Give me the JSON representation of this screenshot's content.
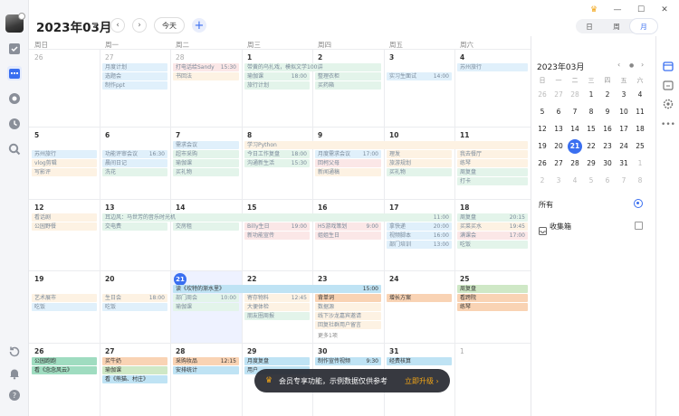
{
  "header": {
    "title": "2023年03月",
    "today_label": "今天",
    "views": [
      "日",
      "周",
      "月"
    ],
    "active_view": "月"
  },
  "weekdays": [
    "周日",
    "周一",
    "周二",
    "周三",
    "周四",
    "周五",
    "周六"
  ],
  "weeks": [
    [
      {
        "d": "26",
        "dim": true
      },
      {
        "d": "27",
        "dim": true
      },
      {
        "d": "28",
        "dim": true
      },
      {
        "d": "1"
      },
      {
        "d": "2"
      },
      {
        "d": "3"
      },
      {
        "d": "4"
      }
    ],
    [
      {
        "d": "5"
      },
      {
        "d": "6"
      },
      {
        "d": "7"
      },
      {
        "d": "8"
      },
      {
        "d": "9"
      },
      {
        "d": "10"
      },
      {
        "d": "11"
      }
    ],
    [
      {
        "d": "12"
      },
      {
        "d": "13"
      },
      {
        "d": "14"
      },
      {
        "d": "15"
      },
      {
        "d": "16"
      },
      {
        "d": "17"
      },
      {
        "d": "18"
      }
    ],
    [
      {
        "d": "19"
      },
      {
        "d": "20"
      },
      {
        "d": "21",
        "today": true
      },
      {
        "d": "22"
      },
      {
        "d": "23"
      },
      {
        "d": "24"
      },
      {
        "d": "25"
      }
    ],
    [
      {
        "d": "26"
      },
      {
        "d": "27"
      },
      {
        "d": "28"
      },
      {
        "d": "29"
      },
      {
        "d": "30"
      },
      {
        "d": "31"
      },
      {
        "d": "1",
        "dim": true
      }
    ]
  ],
  "events": [
    {
      "w": 0,
      "c": 1,
      "s": 1,
      "r": 0,
      "t": "月度计划",
      "time": "",
      "color": "#e0f0fb"
    },
    {
      "w": 0,
      "c": 1,
      "s": 1,
      "r": 1,
      "t": "选题会",
      "time": "",
      "color": "#e0f0fb"
    },
    {
      "w": 0,
      "c": 1,
      "s": 1,
      "r": 2,
      "t": "制作ppt",
      "time": "",
      "color": "#e0f0fb"
    },
    {
      "w": 0,
      "c": 2,
      "s": 1,
      "r": 0,
      "t": "打电话给Sandy",
      "time": "15:30",
      "color": "#fbe7e7"
    },
    {
      "w": 0,
      "c": 2,
      "s": 1,
      "r": 1,
      "t": "书回法",
      "time": "",
      "color": "#fdf2e3"
    },
    {
      "w": 0,
      "c": 3,
      "s": 2,
      "r": 0,
      "t": "带黄的乌扎戏，模拟文学100讲",
      "time": "",
      "color": "#e3f4ea"
    },
    {
      "w": 0,
      "c": 3,
      "s": 1,
      "r": 1,
      "t": "瑜伽课",
      "time": "18:00",
      "color": "#e3f4ea"
    },
    {
      "w": 0,
      "c": 3,
      "s": 1,
      "r": 2,
      "t": "旅行计划",
      "time": "",
      "color": "#e3f4ea"
    },
    {
      "w": 0,
      "c": 4,
      "s": 1,
      "r": 1,
      "t": "整理衣柜",
      "time": "",
      "color": "#e3f4ea"
    },
    {
      "w": 0,
      "c": 4,
      "s": 1,
      "r": 2,
      "t": "买药箱",
      "time": "",
      "color": "#e3f4ea"
    },
    {
      "w": 0,
      "c": 5,
      "s": 1,
      "r": 1,
      "t": "实习生面试",
      "time": "14:00",
      "color": "#e0f0fb"
    },
    {
      "w": 0,
      "c": 6,
      "s": 1,
      "r": 0,
      "t": "苏州旅行",
      "time": "",
      "color": "#e0f0fb"
    },
    {
      "w": 1,
      "c": 0,
      "s": 1,
      "r": 1,
      "t": "苏州旅行",
      "time": "",
      "color": "#e0f0fb"
    },
    {
      "w": 1,
      "c": 0,
      "s": 1,
      "r": 2,
      "t": "vlog剪辑",
      "time": "",
      "color": "#fdf2e3"
    },
    {
      "w": 1,
      "c": 0,
      "s": 1,
      "r": 3,
      "t": "写影评",
      "time": "",
      "color": "#fdf2e3"
    },
    {
      "w": 1,
      "c": 1,
      "s": 1,
      "r": 1,
      "t": "功能评审会议",
      "time": "16:30",
      "color": "#e0f0fb"
    },
    {
      "w": 1,
      "c": 1,
      "s": 1,
      "r": 2,
      "t": "晨间日记",
      "time": "",
      "color": "#e0f0fb"
    },
    {
      "w": 1,
      "c": 1,
      "s": 1,
      "r": 3,
      "t": "洗花",
      "time": "",
      "color": "#e3f4ea"
    },
    {
      "w": 1,
      "c": 2,
      "s": 1,
      "r": 0,
      "t": "需求会议",
      "time": "",
      "color": "#e0f0fb"
    },
    {
      "w": 1,
      "c": 2,
      "s": 1,
      "r": 1,
      "t": "超市采购",
      "time": "",
      "color": "#e3f4ea"
    },
    {
      "w": 1,
      "c": 2,
      "s": 1,
      "r": 2,
      "t": "瑜伽课",
      "time": "",
      "color": "#e3f4ea"
    },
    {
      "w": 1,
      "c": 2,
      "s": 1,
      "r": 3,
      "t": "买礼物",
      "time": "",
      "color": "#e3f4ea"
    },
    {
      "w": 1,
      "c": 3,
      "s": 4,
      "r": 0,
      "t": "学习Python",
      "time": "",
      "color": "#fdf2e3"
    },
    {
      "w": 1,
      "c": 3,
      "s": 1,
      "r": 1,
      "t": "今日工作复盘",
      "time": "18:00",
      "color": "#e3f4ea"
    },
    {
      "w": 1,
      "c": 3,
      "s": 1,
      "r": 2,
      "t": "沟通新生活",
      "time": "15:30",
      "color": "#e3f4ea"
    },
    {
      "w": 1,
      "c": 4,
      "s": 1,
      "r": 1,
      "t": "月度需求会议",
      "time": "17:00",
      "color": "#e0f0fb"
    },
    {
      "w": 1,
      "c": 4,
      "s": 1,
      "r": 2,
      "t": "回柯父母",
      "time": "",
      "color": "#fbe7e7"
    },
    {
      "w": 1,
      "c": 4,
      "s": 1,
      "r": 3,
      "t": "新闻通稿",
      "time": "",
      "color": "#fdf2e3"
    },
    {
      "w": 1,
      "c": 5,
      "s": 1,
      "r": 1,
      "t": "理发",
      "time": "",
      "color": "#fdf2e3"
    },
    {
      "w": 1,
      "c": 5,
      "s": 1,
      "r": 2,
      "t": "旅游规划",
      "time": "",
      "color": "#fdf2e3"
    },
    {
      "w": 1,
      "c": 5,
      "s": 1,
      "r": 3,
      "t": "买礼物",
      "time": "",
      "color": "#e3f4ea"
    },
    {
      "w": 1,
      "c": 6,
      "s": 1,
      "r": 1,
      "t": "我去餐厅",
      "time": "",
      "color": "#fdf2e3"
    },
    {
      "w": 1,
      "c": 6,
      "s": 1,
      "r": 2,
      "t": "练琴",
      "time": "",
      "color": "#fdf2e3"
    },
    {
      "w": 1,
      "c": 6,
      "s": 1,
      "r": 3,
      "t": "周复盘",
      "time": "",
      "color": "#e3f4ea"
    },
    {
      "w": 1,
      "c": 6,
      "s": 1,
      "r": 4,
      "t": "打卡",
      "time": "",
      "color": "#e3f4ea"
    },
    {
      "w": 2,
      "c": 0,
      "s": 1,
      "r": 0,
      "t": "看话剧",
      "time": "",
      "color": "#fdf2e3"
    },
    {
      "w": 2,
      "c": 0,
      "s": 1,
      "r": 1,
      "t": "公园野餐",
      "time": "",
      "color": "#fdf2e3"
    },
    {
      "w": 2,
      "c": 1,
      "s": 5,
      "r": 0,
      "t": "耳边风：马世芳的音乐时光机",
      "time": "11:00",
      "color": "#e3f4ea"
    },
    {
      "w": 2,
      "c": 1,
      "s": 1,
      "r": 1,
      "t": "交电费",
      "time": "",
      "color": "#e3f4ea"
    },
    {
      "w": 2,
      "c": 2,
      "s": 1,
      "r": 1,
      "t": "交房租",
      "time": "",
      "color": "#e3f4ea"
    },
    {
      "w": 2,
      "c": 3,
      "s": 1,
      "r": 1,
      "t": "Billy生日",
      "time": "19:00",
      "color": "#fbe7e7"
    },
    {
      "w": 2,
      "c": 3,
      "s": 1,
      "r": 2,
      "t": "新功能宣传",
      "time": "",
      "color": "#fbe7e7"
    },
    {
      "w": 2,
      "c": 4,
      "s": 1,
      "r": 1,
      "t": "H5游戏策划",
      "time": "9:00",
      "color": "#fbe7e7"
    },
    {
      "w": 2,
      "c": 4,
      "s": 1,
      "r": 2,
      "t": "姐姐生日",
      "time": "",
      "color": "#fbe7e7"
    },
    {
      "w": 2,
      "c": 5,
      "s": 1,
      "r": 1,
      "t": "拿快递",
      "time": "20:00",
      "color": "#e0f0fb"
    },
    {
      "w": 2,
      "c": 5,
      "s": 1,
      "r": 2,
      "t": "视频脚本",
      "time": "16:00",
      "color": "#e0f0fb"
    },
    {
      "w": 2,
      "c": 5,
      "s": 1,
      "r": 3,
      "t": "部门培训",
      "time": "13:00",
      "color": "#e0f0fb"
    },
    {
      "w": 2,
      "c": 6,
      "s": 1,
      "r": 0,
      "t": "周复盘",
      "time": "20:15",
      "color": "#e3f4ea"
    },
    {
      "w": 2,
      "c": 6,
      "s": 1,
      "r": 1,
      "t": "买菜买水",
      "time": "19:45",
      "color": "#fdf2e3"
    },
    {
      "w": 2,
      "c": 6,
      "s": 1,
      "r": 2,
      "t": "满课会",
      "time": "17:00",
      "color": "#fbe7e7"
    },
    {
      "w": 2,
      "c": 6,
      "s": 1,
      "r": 3,
      "t": "吃饭",
      "time": "",
      "color": "#e3f4ea"
    },
    {
      "w": 3,
      "c": 0,
      "s": 1,
      "r": 1,
      "t": "艺术展市",
      "time": "",
      "color": "#fdf2e3"
    },
    {
      "w": 3,
      "c": 0,
      "s": 1,
      "r": 2,
      "t": "吃饭",
      "time": "",
      "color": "#e0f0fb"
    },
    {
      "w": 3,
      "c": 1,
      "s": 1,
      "r": 1,
      "t": "生日会",
      "time": "18:00",
      "color": "#fdf2e3"
    },
    {
      "w": 3,
      "c": 1,
      "s": 1,
      "r": 2,
      "t": "吃饭",
      "time": "",
      "color": "#e0f0fb"
    },
    {
      "w": 3,
      "c": 2,
      "s": 3,
      "r": 0,
      "t": "读《坎特的渐水里》",
      "time": "15:00",
      "color": "#bfe3f4",
      "strong": true
    },
    {
      "w": 3,
      "c": 2,
      "s": 1,
      "r": 1,
      "t": "部门周会",
      "time": "10:00",
      "color": "#e3f4ea"
    },
    {
      "w": 3,
      "c": 2,
      "s": 1,
      "r": 2,
      "t": "瑜伽课",
      "time": "",
      "color": "#e3f4ea"
    },
    {
      "w": 3,
      "c": 3,
      "s": 1,
      "r": 1,
      "t": "寄存物料",
      "time": "12:45",
      "color": "#fdf2e3"
    },
    {
      "w": 3,
      "c": 3,
      "s": 1,
      "r": 2,
      "t": "大便体检",
      "time": "",
      "color": "#fdf2e3"
    },
    {
      "w": 3,
      "c": 3,
      "s": 1,
      "r": 3,
      "t": "朋友圈周报",
      "time": "",
      "color": "#e3f4ea"
    },
    {
      "w": 3,
      "c": 4,
      "s": 1,
      "r": 1,
      "t": "背单词",
      "time": "",
      "color": "#f9d3b4",
      "strong": true
    },
    {
      "w": 3,
      "c": 4,
      "s": 1,
      "r": 2,
      "t": "数据源",
      "time": "",
      "color": "#fdf2e3"
    },
    {
      "w": 3,
      "c": 4,
      "s": 1,
      "r": 3,
      "t": "线下沙龙嘉宾邀请",
      "time": "",
      "color": "#fdf2e3"
    },
    {
      "w": 3,
      "c": 4,
      "s": 1,
      "r": 4,
      "t": "回复社群用户留言",
      "time": "",
      "color": "#fdf2e3"
    },
    {
      "w": 3,
      "c": 5,
      "s": 1,
      "r": 1,
      "t": "增长方案",
      "time": "",
      "color": "#f9d3b4",
      "strong": true
    },
    {
      "w": 3,
      "c": 6,
      "s": 1,
      "r": 0,
      "t": "周复盘",
      "time": "",
      "color": "#cfe8c6",
      "strong": true
    },
    {
      "w": 3,
      "c": 6,
      "s": 1,
      "r": 1,
      "t": "看跨院",
      "time": "",
      "color": "#f9d3b4",
      "strong": true
    },
    {
      "w": 3,
      "c": 6,
      "s": 1,
      "r": 2,
      "t": "练琴",
      "time": "",
      "color": "#f9d3b4",
      "strong": true
    },
    {
      "w": 4,
      "c": 0,
      "s": 1,
      "r": 0,
      "t": "公园跑跑",
      "time": "",
      "color": "#9fdcc0",
      "strong": true
    },
    {
      "w": 4,
      "c": 0,
      "s": 1,
      "r": 1,
      "t": "看《念念风云》",
      "time": "",
      "color": "#9fdcc0",
      "strong": true
    },
    {
      "w": 4,
      "c": 1,
      "s": 1,
      "r": 0,
      "t": "买牛奶",
      "time": "",
      "color": "#f9d3b4",
      "strong": true
    },
    {
      "w": 4,
      "c": 1,
      "s": 1,
      "r": 1,
      "t": "瑜伽课",
      "time": "",
      "color": "#cfe8c6",
      "strong": true
    },
    {
      "w": 4,
      "c": 1,
      "s": 1,
      "r": 2,
      "t": "看《熊猫、村庄》",
      "time": "",
      "color": "#bfe3f4",
      "strong": true
    },
    {
      "w": 4,
      "c": 2,
      "s": 1,
      "r": 0,
      "t": "采购妆品",
      "time": "12:15",
      "color": "#f9d3b4",
      "strong": true
    },
    {
      "w": 4,
      "c": 2,
      "s": 1,
      "r": 1,
      "t": "安排统计",
      "time": "",
      "color": "#bfe3f4",
      "strong": true
    },
    {
      "w": 4,
      "c": 3,
      "s": 1,
      "r": 0,
      "t": "月度复盘",
      "time": "",
      "color": "#bfe3f4",
      "strong": true
    },
    {
      "w": 4,
      "c": 3,
      "s": 1,
      "r": 1,
      "t": "用户",
      "time": "",
      "color": "#bfe3f4",
      "strong": true
    },
    {
      "w": 4,
      "c": 4,
      "s": 1,
      "r": 0,
      "t": "制作宣传视频",
      "time": "9:30",
      "color": "#bfe3f4",
      "strong": true
    },
    {
      "w": 4,
      "c": 5,
      "s": 1,
      "r": 0,
      "t": "经费核算",
      "time": "",
      "color": "#bfe3f4",
      "strong": true
    }
  ],
  "more_label": "更多1项",
  "mini_calendar": {
    "title": "2023年03月",
    "weekdays": [
      "日",
      "一",
      "二",
      "三",
      "四",
      "五",
      "六"
    ],
    "rows": [
      [
        {
          "d": "26",
          "dim": true
        },
        {
          "d": "27",
          "dim": true
        },
        {
          "d": "28",
          "dim": true
        },
        {
          "d": "1"
        },
        {
          "d": "2"
        },
        {
          "d": "3"
        },
        {
          "d": "4"
        }
      ],
      [
        {
          "d": "5"
        },
        {
          "d": "6"
        },
        {
          "d": "7"
        },
        {
          "d": "8"
        },
        {
          "d": "9"
        },
        {
          "d": "10"
        },
        {
          "d": "11"
        }
      ],
      [
        {
          "d": "12"
        },
        {
          "d": "13"
        },
        {
          "d": "14"
        },
        {
          "d": "15"
        },
        {
          "d": "16"
        },
        {
          "d": "17"
        },
        {
          "d": "18"
        }
      ],
      [
        {
          "d": "19"
        },
        {
          "d": "20"
        },
        {
          "d": "21",
          "today": true
        },
        {
          "d": "22"
        },
        {
          "d": "23"
        },
        {
          "d": "24"
        },
        {
          "d": "25"
        }
      ],
      [
        {
          "d": "26"
        },
        {
          "d": "27"
        },
        {
          "d": "28"
        },
        {
          "d": "29"
        },
        {
          "d": "30"
        },
        {
          "d": "31"
        },
        {
          "d": "1",
          "dim": true
        }
      ],
      [
        {
          "d": "2",
          "dim": true
        },
        {
          "d": "3",
          "dim": true
        },
        {
          "d": "4",
          "dim": true
        },
        {
          "d": "5",
          "dim": true
        },
        {
          "d": "6",
          "dim": true
        },
        {
          "d": "7",
          "dim": true
        },
        {
          "d": "8",
          "dim": true
        }
      ]
    ]
  },
  "filters": {
    "all_label": "所有",
    "inbox_label": "收集箱"
  },
  "toast": {
    "text": "会员专享功能，示例数据仅供参考",
    "button": "立即升级 ›"
  },
  "colors": {
    "accent": "#3a6ff0",
    "vip": "#f2a516"
  }
}
